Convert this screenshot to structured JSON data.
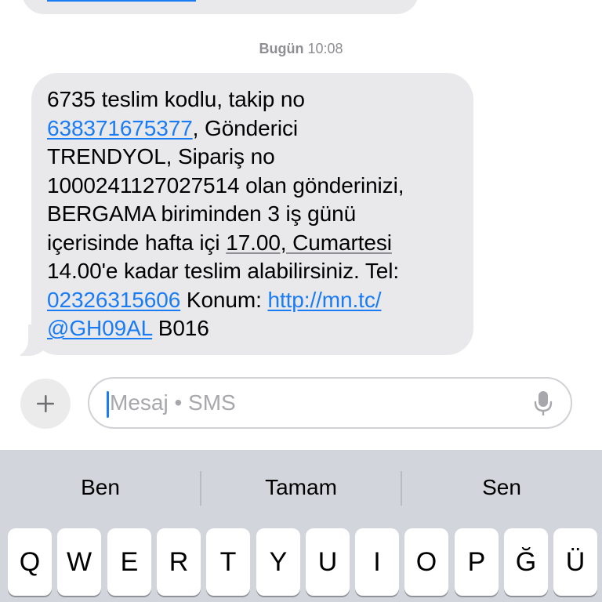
{
  "conversation": {
    "timestamp_day": "Bugün",
    "timestamp_time": "10:08",
    "message": {
      "l1": "6735 teslim kodlu, takip no",
      "l2_link": "638371675377",
      "l2_rest": ", Gönderici",
      "l3": "TRENDYOL, Sipariş no",
      "l4": "1000241127027514 olan gönderinizi,",
      "l5": "BERGAMA biriminden 3 iş günü",
      "l6_pre": "içerisinde hafta içi ",
      "l6_date": "17.00, Cumartesi",
      "l7": "14.00'e kadar teslim alabilirsiniz. Tel:",
      "l8_phone": "02326315606",
      "l8_mid": " Konum: ",
      "l8_url": "http://mn.tc/",
      "l9_url": "@GH09AL",
      "l9_rest": " B016"
    }
  },
  "composer": {
    "placeholder": "Mesaj • SMS",
    "plus_icon": "plus-icon",
    "mic_icon": "microphone-icon"
  },
  "keyboard": {
    "suggestions": [
      "Ben",
      "Tamam",
      "Sen"
    ],
    "row1": [
      "Q",
      "W",
      "E",
      "R",
      "T",
      "Y",
      "U",
      "I",
      "O",
      "P",
      "Ğ",
      "Ü"
    ]
  },
  "colors": {
    "link": "#1a7cf5",
    "bubble": "#e9e9eb",
    "keyboard_bg": "#d2d5db"
  }
}
